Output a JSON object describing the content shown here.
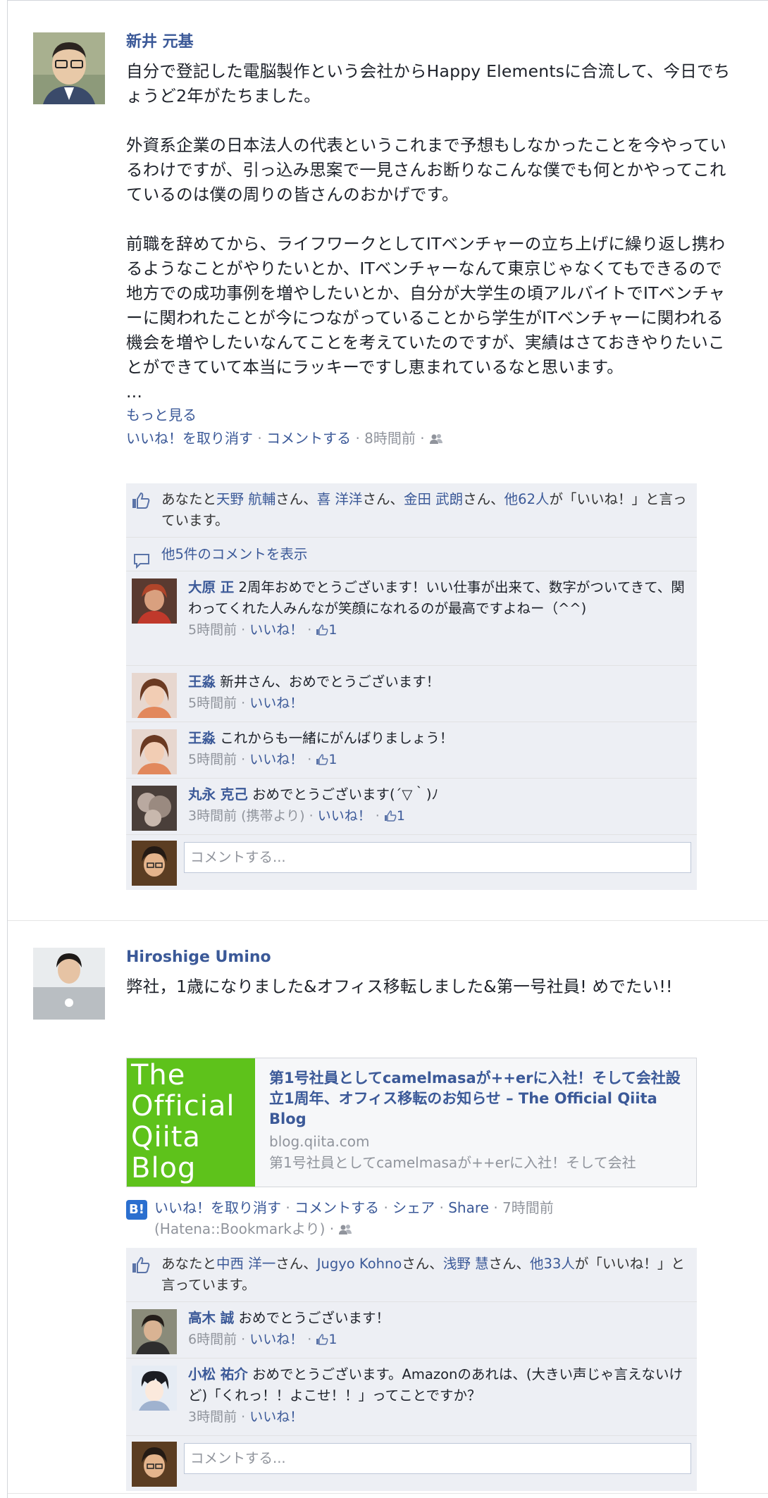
{
  "post1": {
    "author": "新井 元基",
    "message": "自分で登記した電脳製作という会社からHappy Elementsに合流して、今日でちょうど2年がたちました。\n\n外資系企業の日本法人の代表というこれまで予想もしなかったことを今やっているわけですが、引っ込み思案で一見さんお断りなこんな僕でも何とかやってこれているのは僕の周りの皆さんのおかげです。\n\n前職を辞めてから、ライフワークとしてITベンチャーの立ち上げに繰り返し携わるようなことがやりたいとか、ITベンチャーなんて東京じゃなくてもできるので地方での成功事例を増やしたいとか、自分が大学生の頃アルバイトでITベンチャーに関われたことが今につながっていることから学生がITベンチャーに関われる機会を増やしたいなんてことを考えていたのですが、実績はさておきやりたいことができていて本当にラッキーですし恵まれているなと思います。\n...",
    "see_more": "もっと見る",
    "actions": {
      "unlike": "いいね！を取り消す",
      "comment": "コメントする",
      "time": "8時間前"
    },
    "likes": {
      "prefix": "あなたと",
      "p1": "天野 航輔",
      "s1": "さん、",
      "p2": "喜 洋洋",
      "s2": "さん、",
      "p3": "金田 武朗",
      "s3": "さん、",
      "others": "他62人",
      "suffix": "が「いいね！」と言っています。"
    },
    "view_more_comments": "他5件のコメントを表示",
    "comments": [
      {
        "name": "大原 正",
        "text": "2周年おめでとうございます！いい仕事が出来て、数字がついてきて、関わってくれた人みんなが笑顔になれるのが最高ですよねー（^^)",
        "time": "5時間前",
        "like": "いいね！",
        "count": "1",
        "avatar_color": "#7a4a3a"
      },
      {
        "name": "王淼",
        "text": "新井さん、おめでとうございます！",
        "time": "5時間前",
        "like": "いいね！",
        "count": "",
        "avatar_color": "#c98a6b"
      },
      {
        "name": "王淼",
        "text": "これからも一緒にがんばりましょう！",
        "time": "5時間前",
        "like": "いいね！",
        "count": "1",
        "avatar_color": "#c98a6b"
      },
      {
        "name": "丸永 克己",
        "text": "おめでとうございます(´▽｀)ﾉ",
        "time": "3時間前 (携帯より)",
        "like": "いいね！",
        "count": "1",
        "avatar_color": "#8f7a72"
      }
    ],
    "compose_placeholder": "コメントする..."
  },
  "post2": {
    "author": "Hiroshige Umino",
    "message": "弊社，1歳になりました&オフィス移転しました&第一号社員! めでたい!!",
    "link": {
      "thumb_text": "The\nOfficial\nQiita\nBlog",
      "title": "第1号社員としてcamelmasaが++erに入社！そして会社設立1周年、オフィス移転のお知らせ – The Official Qiita Blog",
      "host": "blog.qiita.com",
      "desc": "第1号社員としてcamelmasaが++erに入社！そして会社"
    },
    "actions": {
      "icon": "B!",
      "unlike": "いいね！を取り消す",
      "comment": "コメントする",
      "share_ja": "シェア",
      "share_en": "Share",
      "time": "7時間前",
      "via": "(Hatena::Bookmarkより)"
    },
    "likes": {
      "prefix": "あなたと",
      "p1": "中西 洋一",
      "s1": "さん、",
      "p2": "Jugyo Kohno",
      "s2": "さん、",
      "p3": "浅野 慧",
      "s3": "さん、",
      "others": "他33人",
      "suffix": "が「いいね！」と言っています。"
    },
    "comments": [
      {
        "name": "高木 誠",
        "text": "おめでとうございます！",
        "time": "6時間前",
        "like": "いいね！",
        "count": "1",
        "avatar_color": "#6b6a5c"
      },
      {
        "name": "小松 祐介",
        "text": "おめでとうございます。Amazonのあれは、(大きい声じゃ言えないけど)「くれっ！！よこせ！！」ってことですか？",
        "time": "3時間前",
        "like": "いいね！",
        "count": "",
        "avatar_color": "#cfd6e6"
      }
    ],
    "compose_placeholder": "コメントする..."
  },
  "separator": "·"
}
